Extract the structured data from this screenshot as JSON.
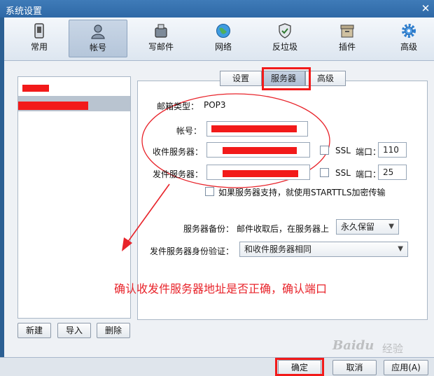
{
  "window": {
    "title": "系统设置",
    "close": "✕"
  },
  "toolbar": {
    "items": [
      {
        "label": "常用",
        "icon": "phone-icon"
      },
      {
        "label": "帐号",
        "icon": "user-icon",
        "active": true
      },
      {
        "label": "写邮件",
        "icon": "write-mail-icon"
      },
      {
        "label": "网络",
        "icon": "globe-icon"
      },
      {
        "label": "反垃圾",
        "icon": "shield-icon"
      },
      {
        "label": "插件",
        "icon": "plugin-box-icon"
      },
      {
        "label": "高级",
        "icon": "gear-icon"
      }
    ]
  },
  "account_buttons": {
    "new": "新建",
    "import": "导入",
    "delete": "删除"
  },
  "tabs": {
    "settings": "设置",
    "server": "服务器",
    "advanced": "高级"
  },
  "form": {
    "mailbox_type_label": "邮箱类型：",
    "mailbox_type_value": "POP3",
    "account_label": "帐号：",
    "incoming_label": "收件服务器：",
    "outgoing_label": "发件服务器：",
    "ssl_label": "SSL",
    "port_label": "端口：",
    "incoming_port": "110",
    "outgoing_port": "25",
    "starttls_label": "如果服务器支持，就使用STARTTLS加密传输",
    "backup_label": "服务器备份：",
    "backup_desc": "邮件收取后，在服务器上",
    "backup_value": "永久保留",
    "auth_label": "发件服务器身份验证：",
    "auth_value": "和收件服务器相同"
  },
  "annotation": "确认收发件服务器地址是否正确，确认端口",
  "footer": {
    "ok": "确定",
    "cancel": "取消",
    "apply": "应用(A)"
  },
  "watermark": {
    "brand": "Baidu",
    "suffix": "经验"
  },
  "colors": {
    "highlight": "#f21a1a",
    "titlebar": "#2e68a6",
    "annotation": "#e8232a"
  }
}
